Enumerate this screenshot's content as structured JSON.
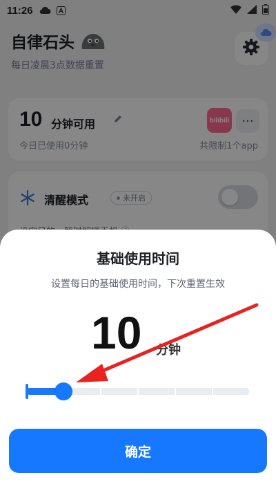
{
  "status_bar": {
    "time": "11:26",
    "icons": [
      "cloud-icon",
      "text-a-icon",
      "wifi-icon",
      "signal-icon",
      "battery-icon"
    ]
  },
  "header": {
    "title": "自律石头",
    "subtitle": "每日凌晨3点数据重置",
    "settings_icon": "gear-icon"
  },
  "limit_card": {
    "minutes": "10",
    "unit": "分钟可用",
    "used_text": "今日已使用0分钟",
    "app_label": "bilibili",
    "more": "···",
    "limit_text": "共限制1个app"
  },
  "sober_card": {
    "name": "清醒模式",
    "status": "未开启",
    "desc": "设定目的，暂时解锁手机 ⓘ",
    "toggle_on": false
  },
  "sheet": {
    "title": "基础使用时间",
    "subtitle": "设置每日的基础使用时间，下次重置生效",
    "value": "10",
    "unit": "分钟",
    "slider_fraction": 0.167,
    "tick_count": 6,
    "confirm_label": "确定"
  },
  "colors": {
    "accent": "#1677ff",
    "annotation_arrow": "#e8231f"
  }
}
